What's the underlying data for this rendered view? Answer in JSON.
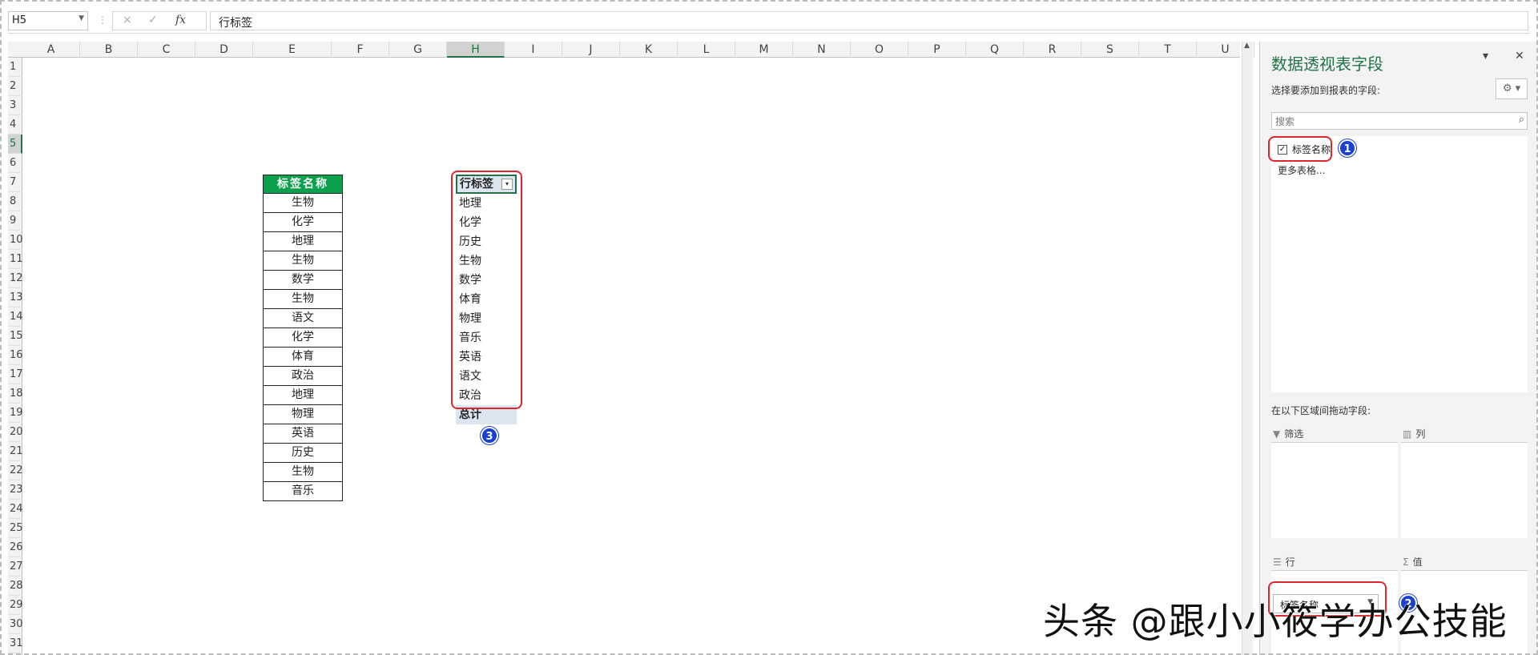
{
  "formula_bar": {
    "name_box": "H5",
    "cancel_icon": "×",
    "enter_icon": "✓",
    "fx_label": "fx",
    "value": "行标签"
  },
  "columns": [
    "A",
    "B",
    "C",
    "D",
    "E",
    "F",
    "G",
    "H",
    "I",
    "J",
    "K",
    "L",
    "M",
    "N",
    "O",
    "P",
    "Q",
    "R",
    "S",
    "T",
    "U"
  ],
  "selected_column": "H",
  "rows": [
    "1",
    "2",
    "3",
    "4",
    "5",
    "6",
    "7",
    "8",
    "9",
    "10",
    "11",
    "12",
    "13",
    "14",
    "15",
    "16",
    "17",
    "18",
    "19",
    "20",
    "21",
    "22",
    "23",
    "24",
    "25",
    "26",
    "27",
    "28",
    "29",
    "30",
    "31"
  ],
  "selected_row": "5",
  "source_table": {
    "header": "标签名称",
    "values": [
      "生物",
      "化学",
      "地理",
      "生物",
      "数学",
      "生物",
      "语文",
      "化学",
      "体育",
      "政治",
      "地理",
      "物理",
      "英语",
      "历史",
      "生物",
      "音乐"
    ]
  },
  "pivot_table": {
    "header": "行标签",
    "dropdown_icon": "▾",
    "items": [
      "地理",
      "化学",
      "历史",
      "生物",
      "数学",
      "体育",
      "物理",
      "音乐",
      "英语",
      "语文",
      "政治"
    ],
    "total": "总计"
  },
  "badges": {
    "one": "1",
    "two": "2",
    "three": "3"
  },
  "pane": {
    "title": "数据透视表字段",
    "subtitle": "选择要添加到报表的字段:",
    "search_placeholder": "搜索",
    "field": {
      "label": "标签名称",
      "checked": true
    },
    "more_tables": "更多表格...",
    "drag_hint": "在以下区域间拖动字段:",
    "areas": {
      "filter": "筛选",
      "columns": "列",
      "rows": "行",
      "values": "值"
    },
    "row_field": "标签名称"
  },
  "watermark": "头条 @跟小小筱学办公技能",
  "colors": {
    "accent": "#217346",
    "header_green": "#0aa04c",
    "highlight_red": "#e0262b",
    "badge_blue": "#1b3fd1"
  }
}
